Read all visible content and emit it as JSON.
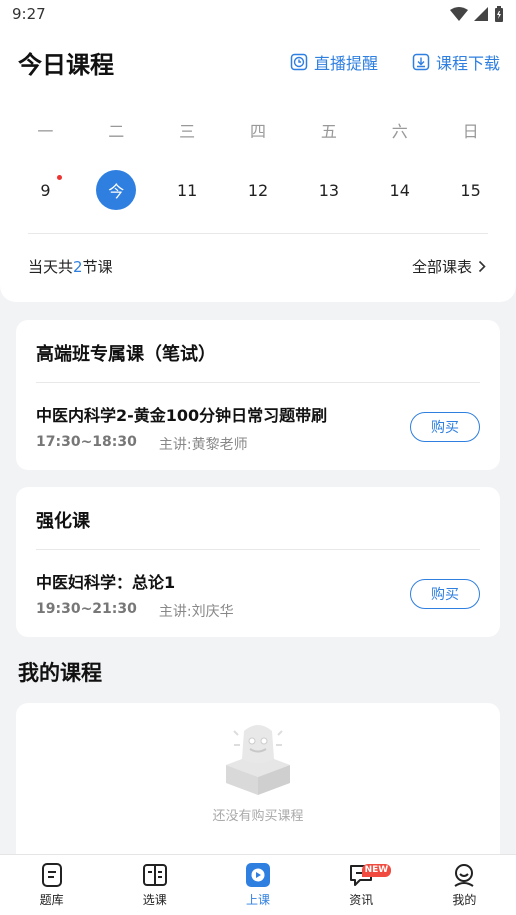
{
  "status_bar": {
    "time": "9:27"
  },
  "header": {
    "title": "今日课程",
    "live_reminder_label": "直播提醒",
    "course_download_label": "课程下载"
  },
  "calendar": {
    "weekdays": [
      "一",
      "二",
      "三",
      "四",
      "五",
      "六",
      "日"
    ],
    "dates": [
      "9",
      "今",
      "11",
      "12",
      "13",
      "14",
      "15"
    ],
    "selected": "今"
  },
  "summary": {
    "prefix": "当天共",
    "count": "2",
    "suffix": "节课",
    "all_schedule_label": "全部课表"
  },
  "courses": [
    {
      "category": "高端班专属课（笔试）",
      "name": "中医内科学2-黄金100分钟日常习题带刷",
      "time": "17:30~18:30",
      "teacher": "主讲:黄黎老师",
      "button": "购买"
    },
    {
      "category": "强化课",
      "name": "中医妇科学：总论1",
      "time": "19:30~21:30",
      "teacher": "主讲:刘庆华",
      "button": "购买"
    }
  ],
  "my_courses": {
    "title": "我的课程",
    "empty_text": "还没有购买课程"
  },
  "tabbar": {
    "items": [
      {
        "label": "题库"
      },
      {
        "label": "选课"
      },
      {
        "label": "上课"
      },
      {
        "label": "资讯",
        "badge": "NEW"
      },
      {
        "label": "我的"
      }
    ],
    "active_index": 2
  },
  "colors": {
    "accent": "#2f7fe0",
    "badge": "#f04b3e",
    "dot": "#e33333"
  }
}
